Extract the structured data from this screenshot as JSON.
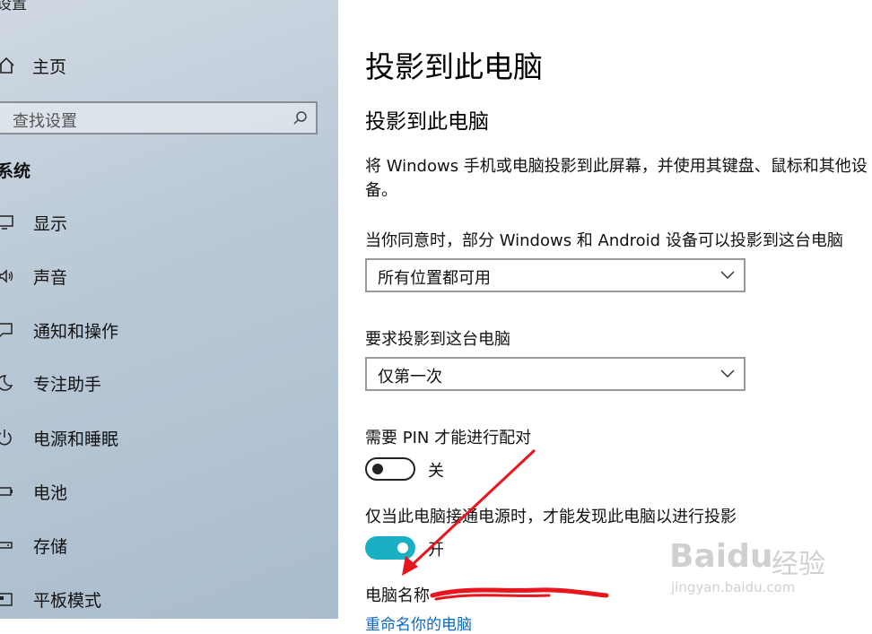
{
  "sidebar": {
    "title": "设置",
    "home_label": "主页",
    "search_placeholder": "查找设置",
    "section_label": "系统",
    "items": [
      {
        "label": "显示",
        "icon": "monitor-icon"
      },
      {
        "label": "声音",
        "icon": "speaker-icon"
      },
      {
        "label": "通知和操作",
        "icon": "message-icon"
      },
      {
        "label": "专注助手",
        "icon": "moon-icon"
      },
      {
        "label": "电源和睡眠",
        "icon": "power-icon"
      },
      {
        "label": "电池",
        "icon": "battery-icon"
      },
      {
        "label": "存储",
        "icon": "drive-icon"
      },
      {
        "label": "平板模式",
        "icon": "tablet-icon"
      }
    ]
  },
  "main": {
    "title": "投影到此电脑",
    "subtitle": "投影到此电脑",
    "description": "将 Windows 手机或电脑投影到此屏幕，并使用其键盘、鼠标和其他设备。",
    "availability_label": "当你同意时，部分 Windows 和 Android 设备可以投影到这台电脑",
    "availability_value": "所有位置都可用",
    "request_label": "要求投影到这台电脑",
    "request_value": "仅第一次",
    "pin_label": "需要 PIN 才能进行配对",
    "pin_state": "关",
    "power_label": "仅当此电脑接通电源时，才能发现此电脑以进行投影",
    "power_state": "开",
    "pc_name_label": "电脑名称",
    "rename_link": "重命名你的电脑"
  },
  "watermark": {
    "brand": "Baidu",
    "sub": "经验",
    "url": "jingyan.baidu.com"
  },
  "colors": {
    "toggle_on": "#1ab0c3",
    "link": "#0a67c4",
    "annotation": "#e8141e"
  }
}
